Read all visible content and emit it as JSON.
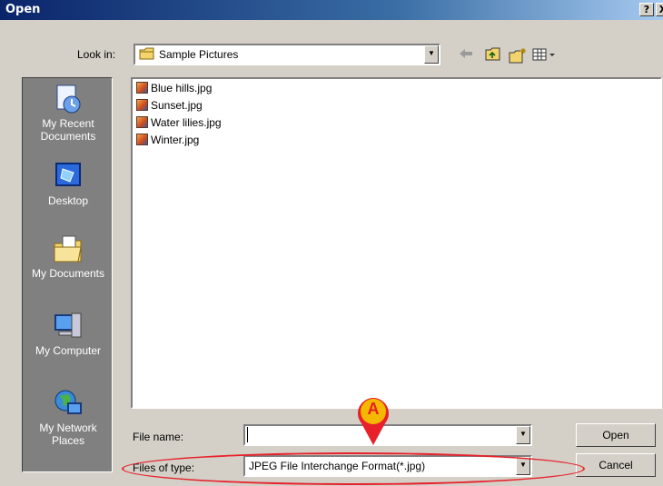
{
  "window": {
    "title": "Open",
    "help_label": "?",
    "close_label": "X"
  },
  "toolbar": {
    "look_in_label": "Look in:",
    "look_in_value": "Sample Pictures",
    "back_icon": "back-arrow-icon",
    "up_icon": "up-folder-icon",
    "new_folder_icon": "new-folder-icon",
    "view_icon": "view-menu-icon"
  },
  "places": {
    "items": [
      {
        "label_line1": "My Recent",
        "label_line2": "Documents",
        "icon": "recent-documents-icon"
      },
      {
        "label_line1": "Desktop",
        "label_line2": "",
        "icon": "desktop-icon"
      },
      {
        "label_line1": "My Documents",
        "label_line2": "",
        "icon": "my-documents-icon"
      },
      {
        "label_line1": "My Computer",
        "label_line2": "",
        "icon": "my-computer-icon"
      },
      {
        "label_line1": "My Network",
        "label_line2": "Places",
        "icon": "network-places-icon"
      }
    ]
  },
  "files": [
    {
      "name": "Blue hills.jpg"
    },
    {
      "name": "Sunset.jpg"
    },
    {
      "name": "Water lilies.jpg"
    },
    {
      "name": "Winter.jpg"
    }
  ],
  "form": {
    "file_name_label": "File name:",
    "file_name_value": "",
    "file_type_label": "Files of type:",
    "file_type_value": "JPEG File Interchange Format(*.jpg)"
  },
  "buttons": {
    "open_label": "Open",
    "cancel_label": "Cancel"
  },
  "annotation": {
    "marker_label": "A",
    "color": "#e8202a",
    "marker_fill": "#f5b800"
  }
}
